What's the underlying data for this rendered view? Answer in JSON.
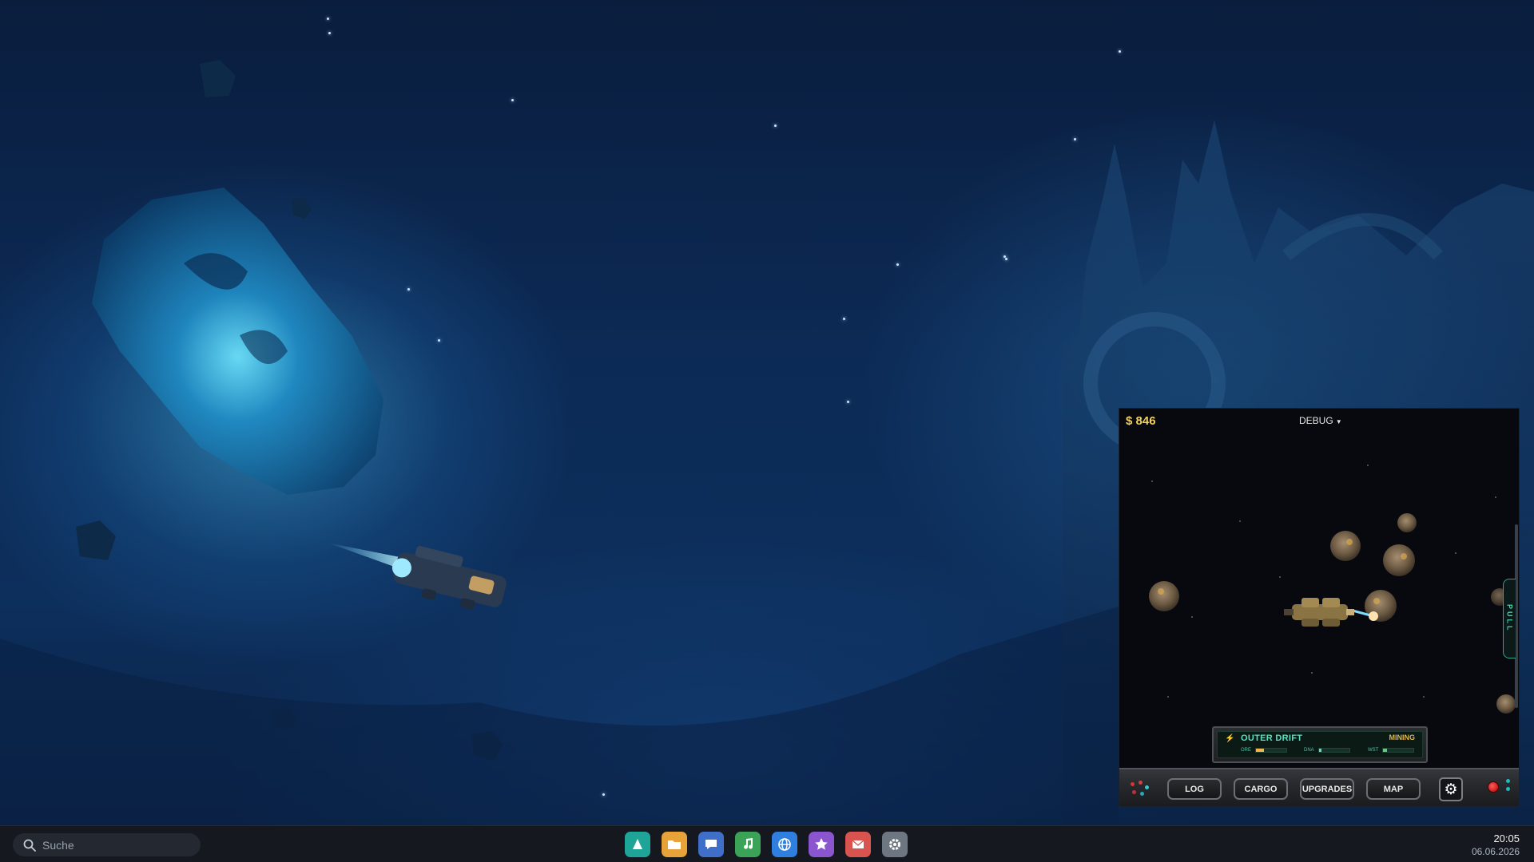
{
  "game": {
    "money": "$ 846",
    "debug_label": "DEBUG",
    "pull_label": "PULL",
    "zone": {
      "name": "OUTER DRIFT",
      "status": "MINING",
      "resources": [
        {
          "label": "ORE",
          "level": 0.25,
          "color": "#f0b64a"
        },
        {
          "label": "DNA",
          "level": 0.1,
          "color": "#59e0c0"
        },
        {
          "label": "WST",
          "level": 0.12,
          "color": "#5bd07a"
        }
      ]
    },
    "toolbar": {
      "buttons": [
        "LOG",
        "CARGO",
        "UPGRADES",
        "MAP"
      ]
    }
  },
  "taskbar": {
    "search_placeholder": "Suche",
    "apps": [
      "launcher-icon",
      "folder-icon",
      "chat-icon",
      "music-icon",
      "browser-icon",
      "star-icon",
      "mail-icon",
      "settings-icon"
    ],
    "time": "20:05",
    "date": "06.06.2026"
  }
}
